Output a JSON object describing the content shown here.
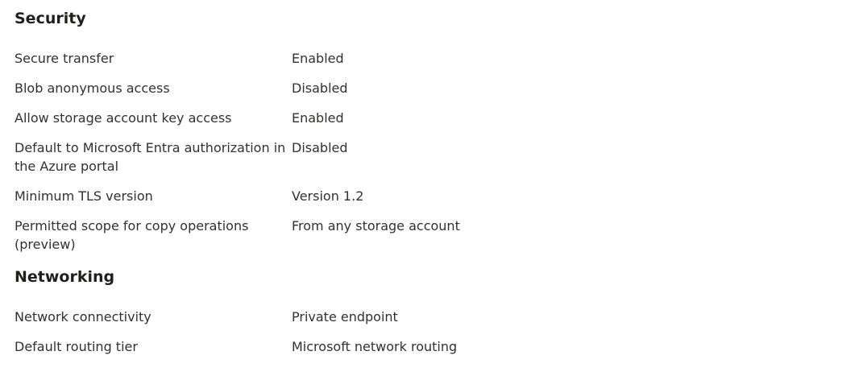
{
  "security": {
    "title": "Security",
    "rows": [
      {
        "key": "Secure transfer",
        "value": "Enabled"
      },
      {
        "key": "Blob anonymous access",
        "value": "Disabled"
      },
      {
        "key": "Allow storage account key access",
        "value": "Enabled"
      },
      {
        "key": "Default to Microsoft Entra authorization in the Azure portal",
        "value": "Disabled"
      },
      {
        "key": "Minimum TLS version",
        "value": "Version 1.2"
      },
      {
        "key": "Permitted scope for copy operations (preview)",
        "value": "From any storage account"
      }
    ]
  },
  "networking": {
    "title": "Networking",
    "rows": [
      {
        "key": "Network connectivity",
        "value": "Private endpoint"
      },
      {
        "key": "Default routing tier",
        "value": "Microsoft network routing"
      }
    ]
  }
}
